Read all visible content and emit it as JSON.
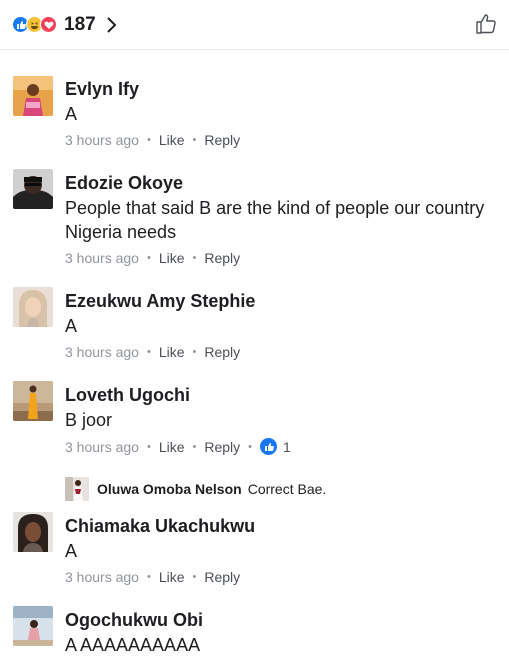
{
  "header": {
    "reaction_count": "187",
    "reactions": [
      "like-icon",
      "haha-icon",
      "love-icon"
    ]
  },
  "comments": [
    {
      "name": "Evlyn Ify",
      "text": "A",
      "time": "3 hours ago",
      "like": "Like",
      "reply": "Reply"
    },
    {
      "name": "Edozie Okoye",
      "text": "People that said B are the kind of people our country Nigeria needs",
      "time": "3 hours ago",
      "like": "Like",
      "reply": "Reply"
    },
    {
      "name": "Ezeukwu Amy Stephie",
      "text": "A",
      "time": "3 hours ago",
      "like": "Like",
      "reply": "Reply"
    },
    {
      "name": "Loveth Ugochi",
      "text": "B joor",
      "time": "3 hours ago",
      "like": "Like",
      "reply": "Reply",
      "likes": "1",
      "reply_preview": {
        "name": "Oluwa Omoba Nelson",
        "text": "Correct  Bae."
      }
    },
    {
      "name": "Chiamaka Ukachukwu",
      "text": "A",
      "time": "3 hours ago",
      "like": "Like",
      "reply": "Reply"
    },
    {
      "name": "Ogochukwu Obi",
      "text": "A AAAAAAAAAA"
    }
  ],
  "colors": {
    "accent": "#1877f2",
    "meta": "#90949c",
    "action": "#4b4f56"
  }
}
